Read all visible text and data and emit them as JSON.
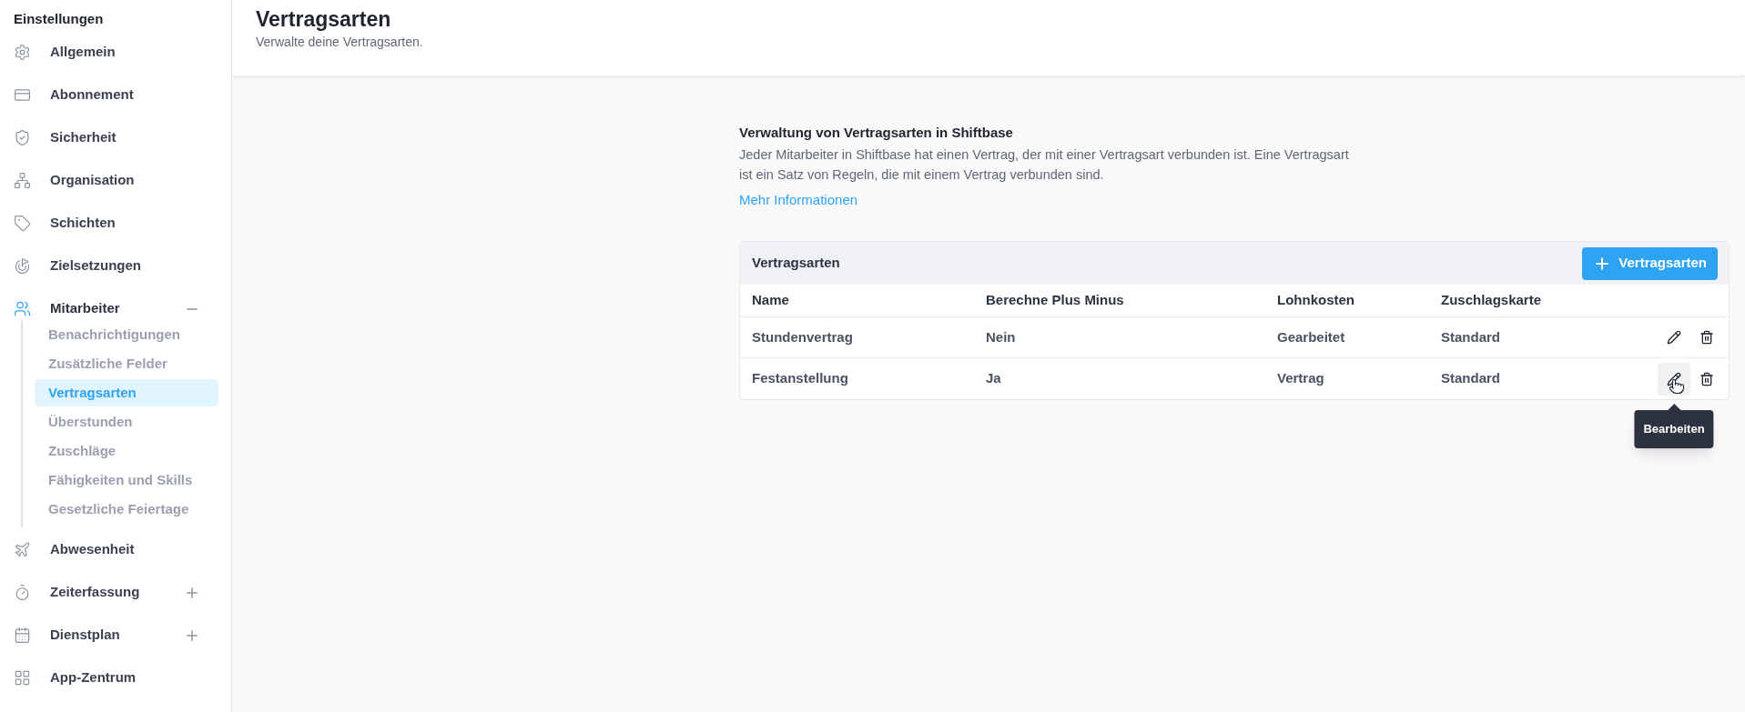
{
  "sidebar": {
    "title": "Einstellungen",
    "items": [
      {
        "label": "Allgemein"
      },
      {
        "label": "Abonnement"
      },
      {
        "label": "Sicherheit"
      },
      {
        "label": "Organisation"
      },
      {
        "label": "Schichten"
      },
      {
        "label": "Zielsetzungen"
      },
      {
        "label": "Mitarbeiter",
        "expanded": true,
        "active": true,
        "children": [
          {
            "label": "Benachrichtigungen",
            "selected": false
          },
          {
            "label": "Zusätzliche Felder",
            "selected": false
          },
          {
            "label": "Vertragsarten",
            "selected": true
          },
          {
            "label": "Überstunden",
            "selected": false
          },
          {
            "label": "Zuschläge",
            "selected": false
          },
          {
            "label": "Fähigkeiten und Skills",
            "selected": false
          },
          {
            "label": "Gesetzliche Feiertage",
            "selected": false
          }
        ]
      },
      {
        "label": "Abwesenheit"
      },
      {
        "label": "Zeiterfassung",
        "expanded": false,
        "active": false
      },
      {
        "label": "Dienstplan",
        "expanded": false,
        "active": false
      },
      {
        "label": "App-Zentrum"
      }
    ]
  },
  "header": {
    "title": "Vertragsarten",
    "subtitle": "Verwalte deine Vertragsarten."
  },
  "intro": {
    "heading": "Verwaltung von Vertragsarten in Shiftbase",
    "text": "Jeder Mitarbeiter in Shiftbase hat einen Vertrag, der mit einer Vertragsart verbunden ist. Eine Vertragsart ist ein Satz von Regeln, die mit einem Vertrag verbunden sind.",
    "link": "Mehr Informationen"
  },
  "table": {
    "title": "Vertragsarten",
    "add_button": "Vertragsarten",
    "columns": [
      "Name",
      "Berechne Plus Minus",
      "Lohnkosten",
      "Zuschlagskarte"
    ],
    "rows": [
      {
        "cells": [
          "Stundenvertrag",
          "Nein",
          "Gearbeitet",
          "Standard"
        ],
        "edit_hovered": false
      },
      {
        "cells": [
          "Festanstellung",
          "Ja",
          "Vertrag",
          "Standard"
        ],
        "edit_hovered": true,
        "tooltip": "Bearbeiten"
      }
    ]
  }
}
